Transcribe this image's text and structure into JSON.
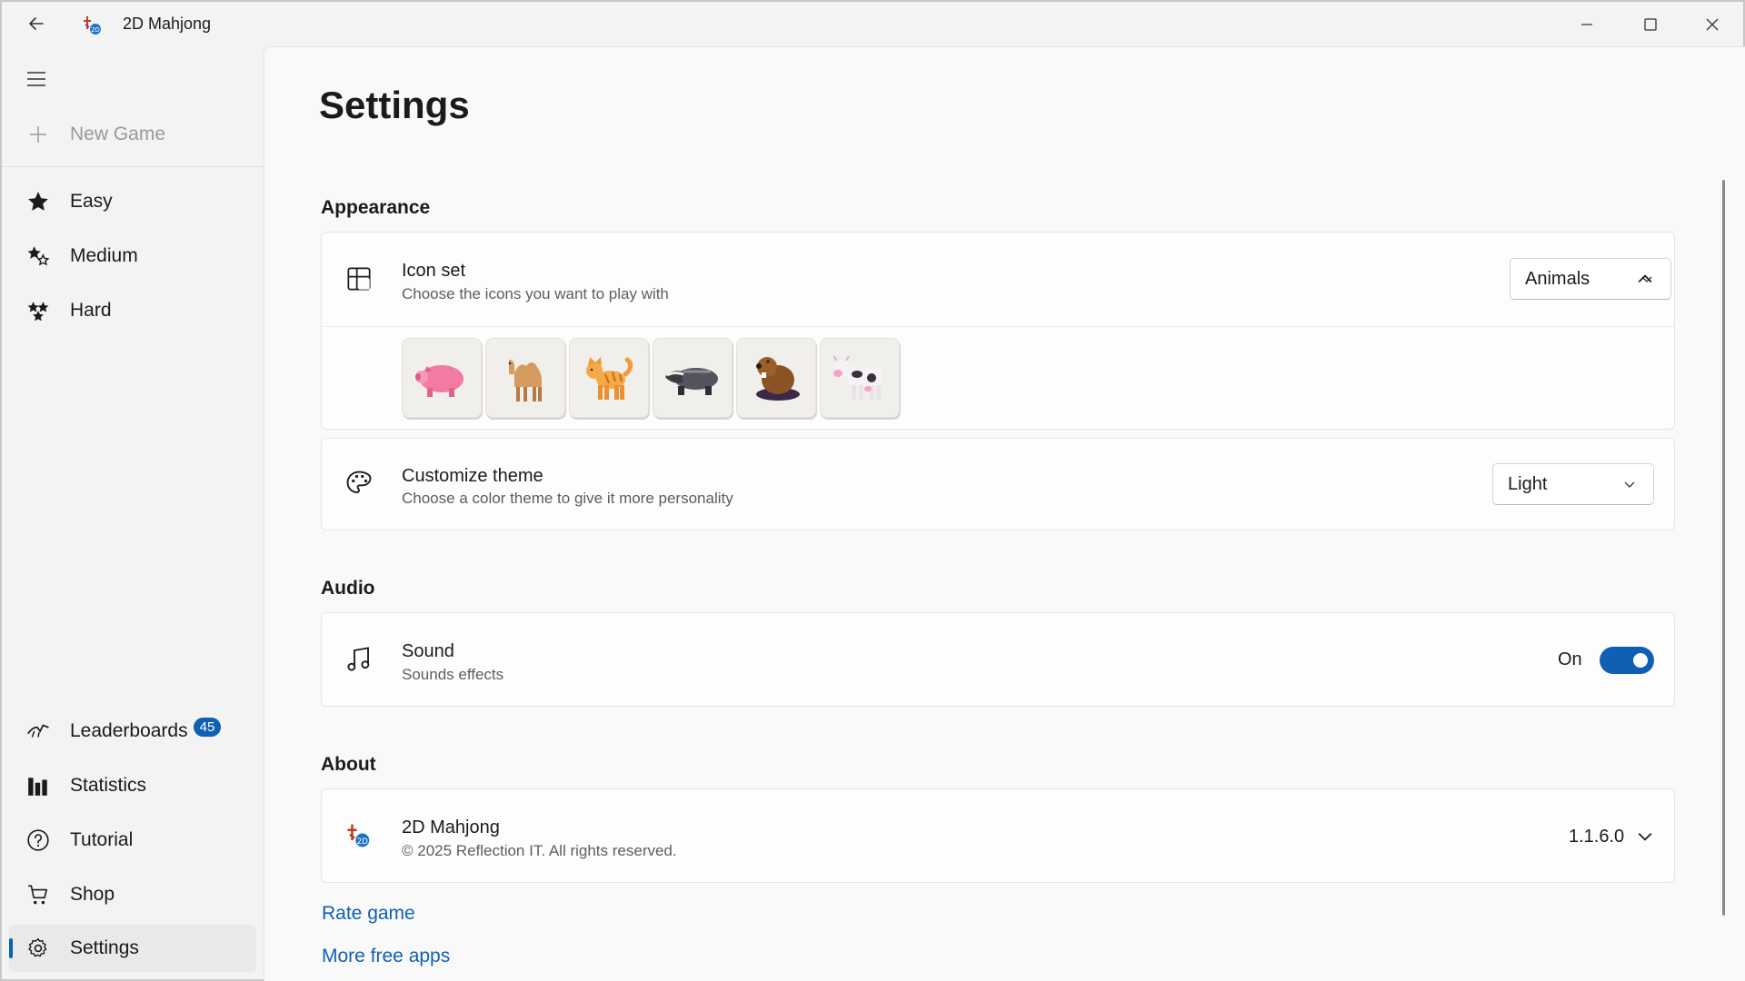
{
  "window": {
    "title": "2D Mahjong",
    "icons": {
      "back": "back-arrow-icon",
      "app": "app-icon",
      "minimize": "minimize-icon",
      "maximize": "maximize-icon",
      "close": "close-icon"
    }
  },
  "sidebar": {
    "new_game": "New Game",
    "items": [
      {
        "label": "Easy",
        "icon": "star-icon"
      },
      {
        "label": "Medium",
        "icon": "star-sparkle-icon"
      },
      {
        "label": "Hard",
        "icon": "stars-icon"
      }
    ],
    "bottom_items": [
      {
        "label": "Leaderboards",
        "icon": "leaderboard-icon",
        "badge": "45"
      },
      {
        "label": "Statistics",
        "icon": "bar-chart-icon"
      },
      {
        "label": "Tutorial",
        "icon": "help-icon"
      },
      {
        "label": "Shop",
        "icon": "cart-icon"
      },
      {
        "label": "Settings",
        "icon": "gear-icon",
        "selected": true
      }
    ]
  },
  "page": {
    "title": "Settings",
    "appearance": {
      "header": "Appearance",
      "icon_set": {
        "title": "Icon set",
        "description": "Choose the icons you want to play with",
        "value": "Animals",
        "tiles": [
          "pig",
          "camel",
          "cat",
          "badger",
          "beaver",
          "cow"
        ]
      },
      "theme": {
        "title": "Customize theme",
        "description": "Choose a color theme to give it more personality",
        "value": "Light"
      }
    },
    "audio": {
      "header": "Audio",
      "sound": {
        "title": "Sound",
        "description": "Sounds effects",
        "state": "On"
      }
    },
    "about": {
      "header": "About",
      "app_name": "2D Mahjong",
      "copyright": "© 2025 Reflection IT. All rights reserved.",
      "version": "1.1.6.0"
    },
    "links": {
      "rate": "Rate game",
      "more_apps": "More free apps"
    }
  },
  "colors": {
    "accent": "#0f5fb5",
    "background": "#f3f3f3",
    "card": "#fdfdfd"
  }
}
